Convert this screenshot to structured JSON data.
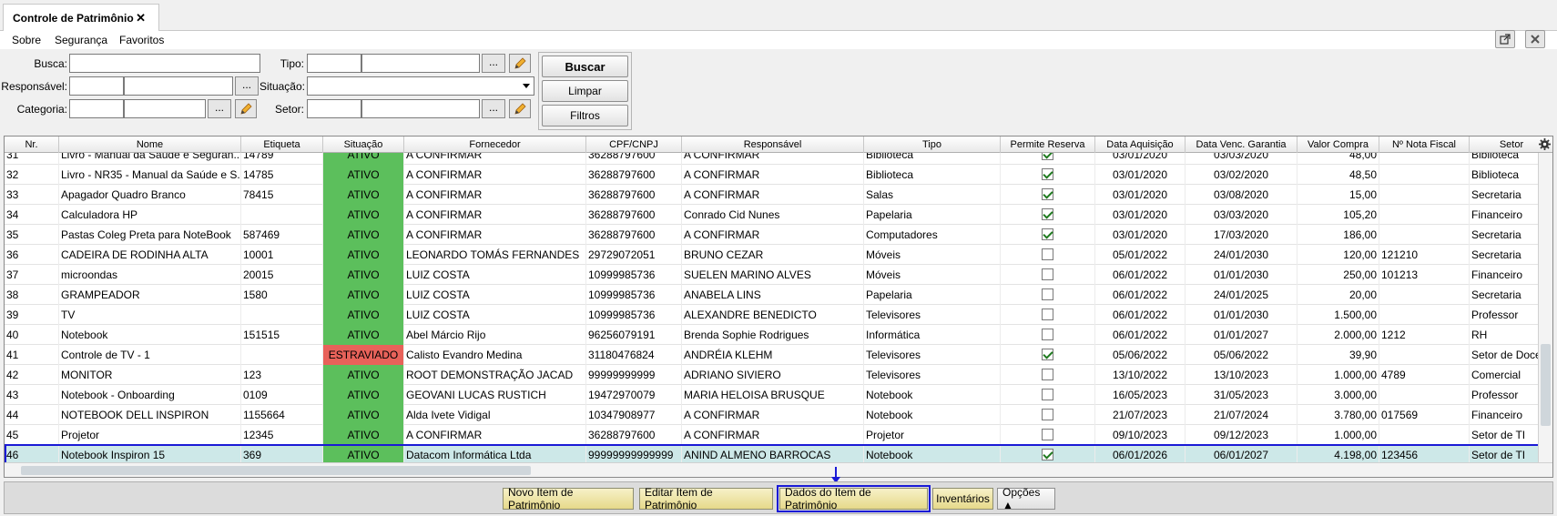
{
  "tab": {
    "title": "Controle de Patrimônio",
    "close": "✕"
  },
  "menu": [
    "Sobre",
    "Segurança",
    "Favoritos"
  ],
  "filters": {
    "busca": "Busca:",
    "responsavel": "Responsável:",
    "categoria": "Categoria:",
    "tipo": "Tipo:",
    "situacao": "Situação:",
    "setor": "Setor:",
    "dots": "...",
    "buscar": "Buscar",
    "limpar": "Limpar",
    "filtros": "Filtros"
  },
  "columns": [
    "Nr.",
    "Nome",
    "Etiqueta",
    "Situação",
    "Fornecedor",
    "CPF/CNPJ",
    "Responsável",
    "Tipo",
    "Permite Reserva",
    "Data Aquisição",
    "Data Venc. Garantia",
    "Valor Compra",
    "Nº Nota Fiscal",
    "Setor"
  ],
  "rows": [
    {
      "nr": "31",
      "nome": "Livro - Manual da Saúde e Seguran...",
      "etiqueta": "14789",
      "situacao": "ATIVO",
      "fornecedor": "A CONFIRMAR",
      "cpf": "36288797600",
      "responsavel": "A CONFIRMAR",
      "tipo": "Biblioteca",
      "reserva": true,
      "aquis": "03/01/2020",
      "garantia": "03/03/2020",
      "valor": "48,00",
      "nota": "",
      "setor": "Biblioteca"
    },
    {
      "nr": "32",
      "nome": "Livro - NR35 - Manual da Saúde e S...",
      "etiqueta": "14785",
      "situacao": "ATIVO",
      "fornecedor": "A CONFIRMAR",
      "cpf": "36288797600",
      "responsavel": "A CONFIRMAR",
      "tipo": "Biblioteca",
      "reserva": true,
      "aquis": "03/01/2020",
      "garantia": "03/02/2020",
      "valor": "48,50",
      "nota": "",
      "setor": "Biblioteca"
    },
    {
      "nr": "33",
      "nome": "Apagador Quadro Branco",
      "etiqueta": "78415",
      "situacao": "ATIVO",
      "fornecedor": "A CONFIRMAR",
      "cpf": "36288797600",
      "responsavel": "A CONFIRMAR",
      "tipo": "Salas",
      "reserva": true,
      "aquis": "03/01/2020",
      "garantia": "03/08/2020",
      "valor": "15,00",
      "nota": "",
      "setor": "Secretaria"
    },
    {
      "nr": "34",
      "nome": "Calculadora HP",
      "etiqueta": "",
      "situacao": "ATIVO",
      "fornecedor": "A CONFIRMAR",
      "cpf": "36288797600",
      "responsavel": "Conrado Cid Nunes",
      "tipo": "Papelaria",
      "reserva": true,
      "aquis": "03/01/2020",
      "garantia": "03/03/2020",
      "valor": "105,20",
      "nota": "",
      "setor": "Financeiro"
    },
    {
      "nr": "35",
      "nome": "Pastas Coleg Preta para NoteBook",
      "etiqueta": "587469",
      "situacao": "ATIVO",
      "fornecedor": "A CONFIRMAR",
      "cpf": "36288797600",
      "responsavel": "A CONFIRMAR",
      "tipo": "Computadores",
      "reserva": true,
      "aquis": "03/01/2020",
      "garantia": "17/03/2020",
      "valor": "186,00",
      "nota": "",
      "setor": "Secretaria"
    },
    {
      "nr": "36",
      "nome": "CADEIRA DE RODINHA ALTA",
      "etiqueta": "10001",
      "situacao": "ATIVO",
      "fornecedor": "LEONARDO TOMÁS FERNANDES",
      "cpf": "29729072051",
      "responsavel": "BRUNO CEZAR",
      "tipo": "Móveis",
      "reserva": false,
      "aquis": "05/01/2022",
      "garantia": "24/01/2030",
      "valor": "120,00",
      "nota": "121210",
      "setor": "Secretaria"
    },
    {
      "nr": "37",
      "nome": "microondas",
      "etiqueta": "20015",
      "situacao": "ATIVO",
      "fornecedor": "LUIZ COSTA",
      "cpf": "10999985736",
      "responsavel": "SUELEN MARINO ALVES",
      "tipo": "Móveis",
      "reserva": false,
      "aquis": "06/01/2022",
      "garantia": "01/01/2030",
      "valor": "250,00",
      "nota": "101213",
      "setor": "Financeiro"
    },
    {
      "nr": "38",
      "nome": "GRAMPEADOR",
      "etiqueta": "1580",
      "situacao": "ATIVO",
      "fornecedor": "LUIZ COSTA",
      "cpf": "10999985736",
      "responsavel": "ANABELA LINS",
      "tipo": "Papelaria",
      "reserva": false,
      "aquis": "06/01/2022",
      "garantia": "24/01/2025",
      "valor": "20,00",
      "nota": "",
      "setor": "Secretaria"
    },
    {
      "nr": "39",
      "nome": "TV",
      "etiqueta": "",
      "situacao": "ATIVO",
      "fornecedor": "LUIZ COSTA",
      "cpf": "10999985736",
      "responsavel": "ALEXANDRE BENEDICTO",
      "tipo": "Televisores",
      "reserva": false,
      "aquis": "06/01/2022",
      "garantia": "01/01/2030",
      "valor": "1.500,00",
      "nota": "",
      "setor": "Professor"
    },
    {
      "nr": "40",
      "nome": "Notebook",
      "etiqueta": "151515",
      "situacao": "ATIVO",
      "fornecedor": "Abel Márcio Rijo",
      "cpf": "96256079191",
      "responsavel": "Brenda Sophie Rodrigues",
      "tipo": "Informática",
      "reserva": false,
      "aquis": "06/01/2022",
      "garantia": "01/01/2027",
      "valor": "2.000,00",
      "nota": "1212",
      "setor": "RH"
    },
    {
      "nr": "41",
      "nome": "Controle de TV - 1",
      "etiqueta": "",
      "situacao": "ESTRAVIADO",
      "fornecedor": "Calisto Evandro Medina",
      "cpf": "31180476824",
      "responsavel": "ANDRÉIA KLEHM",
      "tipo": "Televisores",
      "reserva": true,
      "aquis": "05/06/2022",
      "garantia": "05/06/2022",
      "valor": "39,90",
      "nota": "",
      "setor": "Setor de Docen"
    },
    {
      "nr": "42",
      "nome": "MONITOR",
      "etiqueta": "123",
      "situacao": "ATIVO",
      "fornecedor": "ROOT DEMONSTRAÇÃO JACAD",
      "cpf": "99999999999",
      "responsavel": "ADRIANO SIVIERO",
      "tipo": "Televisores",
      "reserva": false,
      "aquis": "13/10/2022",
      "garantia": "13/10/2023",
      "valor": "1.000,00",
      "nota": "4789",
      "setor": "Comercial"
    },
    {
      "nr": "43",
      "nome": "Notebook - Onboarding",
      "etiqueta": "0109",
      "situacao": "ATIVO",
      "fornecedor": "GEOVANI LUCAS RUSTICH",
      "cpf": "19472970079",
      "responsavel": "MARIA HELOISA BRUSQUE",
      "tipo": "Notebook",
      "reserva": false,
      "aquis": "16/05/2023",
      "garantia": "31/05/2023",
      "valor": "3.000,00",
      "nota": "",
      "setor": "Professor"
    },
    {
      "nr": "44",
      "nome": "NOTEBOOK DELL INSPIRON",
      "etiqueta": "1155664",
      "situacao": "ATIVO",
      "fornecedor": "Alda Ivete Vidigal",
      "cpf": "10347908977",
      "responsavel": "A CONFIRMAR",
      "tipo": "Notebook",
      "reserva": false,
      "aquis": "21/07/2023",
      "garantia": "21/07/2024",
      "valor": "3.780,00",
      "nota": "017569",
      "setor": "Financeiro"
    },
    {
      "nr": "45",
      "nome": "Projetor",
      "etiqueta": "12345",
      "situacao": "ATIVO",
      "fornecedor": "A CONFIRMAR",
      "cpf": "36288797600",
      "responsavel": "A CONFIRMAR",
      "tipo": "Projetor",
      "reserva": false,
      "aquis": "09/10/2023",
      "garantia": "09/12/2023",
      "valor": "1.000,00",
      "nota": "",
      "setor": "Setor de TI"
    },
    {
      "nr": "46",
      "nome": "Notebook Inspiron 15",
      "etiqueta": "369",
      "situacao": "ATIVO",
      "fornecedor": "Datacom Informática Ltda",
      "cpf": "99999999999999",
      "responsavel": "ANIND ALMENO BARROCAS",
      "tipo": "Notebook",
      "reserva": true,
      "aquis": "06/01/2026",
      "garantia": "06/01/2027",
      "valor": "4.198,00",
      "nota": "123456",
      "setor": "Setor de TI"
    }
  ],
  "selected_row": 15,
  "status_colors": {
    "ATIVO": "#5cbf5c",
    "ESTRAVIADO": "#e8625a"
  },
  "actions": [
    "Novo Item de Patrimônio",
    "Editar Item de Patrimônio",
    "Dados do Item de Patrimônio",
    "Inventários",
    "Opções ▲"
  ]
}
